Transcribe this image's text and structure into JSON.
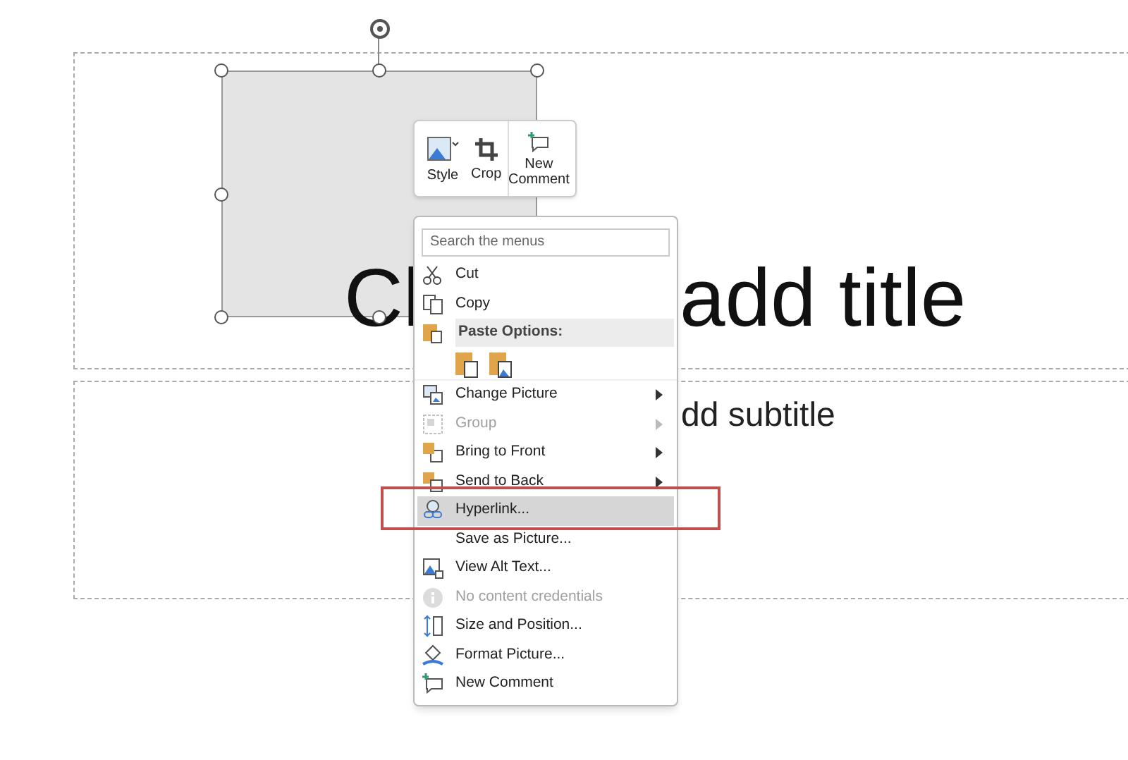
{
  "slide": {
    "title_parts": [
      "Cl",
      "add title"
    ],
    "subtitle_part": "dd subtitle"
  },
  "mini_toolbar": [
    {
      "label": "Style"
    },
    {
      "label": "Crop"
    },
    {
      "label": "New Comment"
    }
  ],
  "context_menu": {
    "search_placeholder": "Search the menus",
    "items": [
      {
        "kind": "item",
        "label": "Cut",
        "disabled": false,
        "selected": false,
        "submenu": false
      },
      {
        "kind": "item",
        "label": "Copy",
        "disabled": false,
        "selected": false,
        "submenu": false
      },
      {
        "kind": "header",
        "label": "Paste Options:"
      },
      {
        "kind": "paste"
      },
      {
        "kind": "item",
        "label": "Change Picture",
        "disabled": false,
        "selected": false,
        "submenu": true
      },
      {
        "kind": "item",
        "label": "Group",
        "disabled": true,
        "selected": false,
        "submenu": true
      },
      {
        "kind": "item",
        "label": "Bring to Front",
        "disabled": false,
        "selected": false,
        "submenu": true
      },
      {
        "kind": "item",
        "label": "Send to Back",
        "disabled": false,
        "selected": false,
        "submenu": true
      },
      {
        "kind": "item",
        "label": "Hyperlink...",
        "disabled": false,
        "selected": true,
        "submenu": false
      },
      {
        "kind": "item",
        "label": "Save as Picture...",
        "disabled": false,
        "selected": false,
        "submenu": false
      },
      {
        "kind": "item",
        "label": "View Alt Text...",
        "disabled": false,
        "selected": false,
        "submenu": false
      },
      {
        "kind": "item",
        "label": "No content credentials",
        "disabled": true,
        "selected": false,
        "submenu": false
      },
      {
        "kind": "item",
        "label": "Size and Position...",
        "disabled": false,
        "selected": false,
        "submenu": false
      },
      {
        "kind": "item",
        "label": "Format Picture...",
        "disabled": false,
        "selected": false,
        "submenu": false
      },
      {
        "kind": "item",
        "label": "New Comment",
        "disabled": false,
        "selected": false,
        "submenu": false
      }
    ]
  }
}
